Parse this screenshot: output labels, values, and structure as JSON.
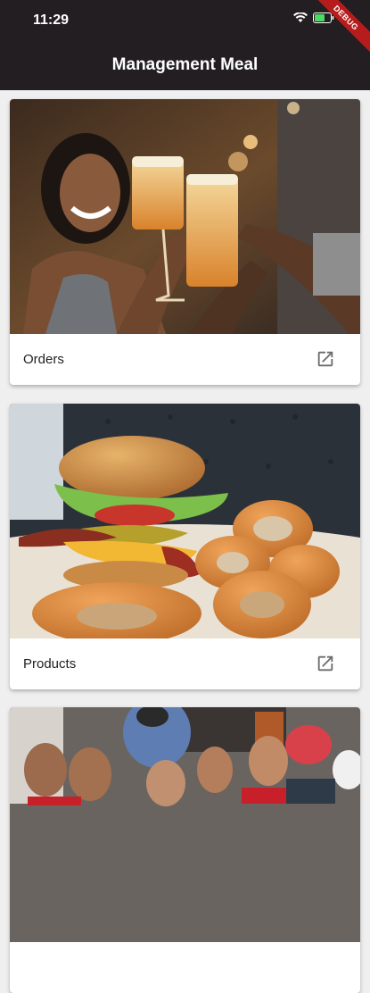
{
  "status_bar": {
    "time": "11:29"
  },
  "app_bar": {
    "title": "Management Meal",
    "debug_label": "DEBUG"
  },
  "cards": [
    {
      "label": "Orders",
      "image": "people-toasting-beers-photo"
    },
    {
      "label": "Products",
      "image": "burger-and-onion-rings-photo"
    },
    {
      "label": "",
      "image": "crowd-of-sports-fans-photo"
    }
  ],
  "colors": {
    "app_bar": "#231e22",
    "background": "#efefef",
    "debug_banner": "#b71c1c"
  }
}
